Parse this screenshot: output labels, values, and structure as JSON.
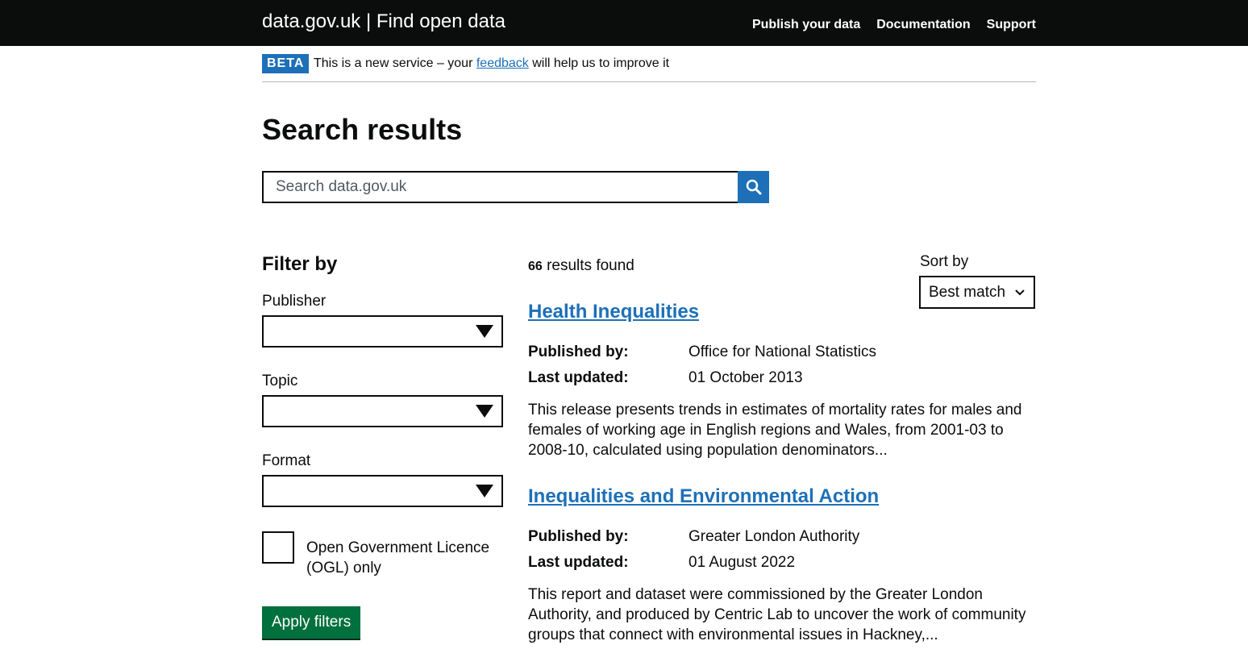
{
  "header": {
    "brand": "data.gov.uk | Find open data",
    "nav": [
      "Publish your data",
      "Documentation",
      "Support"
    ]
  },
  "beta": {
    "tag": "BETA",
    "text_before": "This is a new service – your ",
    "link": "feedback",
    "text_after": " will help us to improve it"
  },
  "page_title": "Search results",
  "search": {
    "placeholder": "Search data.gov.uk",
    "value": "",
    "button_icon": "search-icon"
  },
  "filters": {
    "title": "Filter by",
    "publisher_label": "Publisher",
    "publisher_value": "",
    "topic_label": "Topic",
    "topic_value": "",
    "format_label": "Format",
    "format_value": "",
    "ogl_label": "Open Government Licence (OGL) only",
    "ogl_checked": false,
    "apply_button": "Apply filters"
  },
  "results": {
    "count": "66",
    "count_suffix": " results found",
    "sort_label": "Sort by",
    "sort_value": "Best match",
    "published_by_label": "Published by:",
    "last_updated_label": "Last updated:",
    "items": [
      {
        "title": "Health Inequalities",
        "publisher": "Office for National Statistics",
        "updated": "01 October 2013",
        "description": "This release presents trends in estimates of mortality rates for males and females of working age in English regions and Wales, from 2001-03 to 2008-10, calculated using population denominators..."
      },
      {
        "title": "Inequalities and Environmental Action",
        "publisher": "Greater London Authority",
        "updated": "01 August 2022",
        "description": "This report and dataset were commissioned by the Greater London Authority, and produced by Centric Lab to uncover the work of community groups that connect with environmental issues in Hackney,..."
      }
    ]
  },
  "colors": {
    "header_bg": "#0b0c0c",
    "link": "#1d70b8",
    "button_green": "#00703c",
    "beta_tag": "#1d70b8"
  }
}
